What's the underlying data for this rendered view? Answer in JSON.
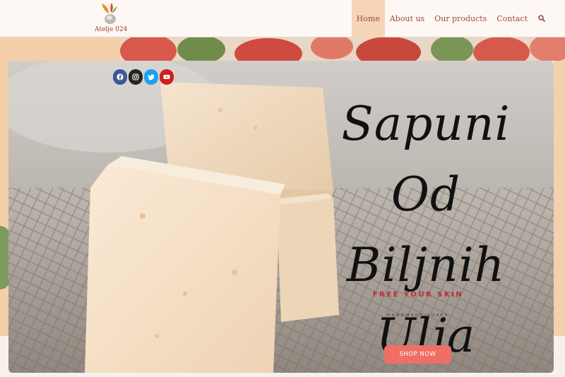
{
  "brand": {
    "name": "Atelje 024"
  },
  "nav": {
    "items": [
      {
        "label": "Home",
        "active": true
      },
      {
        "label": "About us",
        "active": false
      },
      {
        "label": "Our products",
        "active": false
      },
      {
        "label": "Contact",
        "active": false
      }
    ],
    "search_icon": "search-icon"
  },
  "social": [
    {
      "icon": "facebook-icon",
      "color": "#3b5998"
    },
    {
      "icon": "instagram-icon",
      "color": "#262626"
    },
    {
      "icon": "twitter-icon",
      "color": "#1da1f2"
    },
    {
      "icon": "youtube-icon",
      "color": "#cd201f"
    }
  ],
  "hero": {
    "title_line1": "Sapuni Od",
    "title_line2": "Biljnih",
    "title_line3": "Ulja",
    "tagline": "FREE YOUR SKIN",
    "subtag": "HANDMADE SOAPS",
    "cta_label": "SHOP NOW"
  },
  "colors": {
    "accent": "#ef6e67",
    "nav_text": "#9c4b3c",
    "nav_active_bg": "#f6d5b6",
    "tagline": "#c0282a"
  }
}
